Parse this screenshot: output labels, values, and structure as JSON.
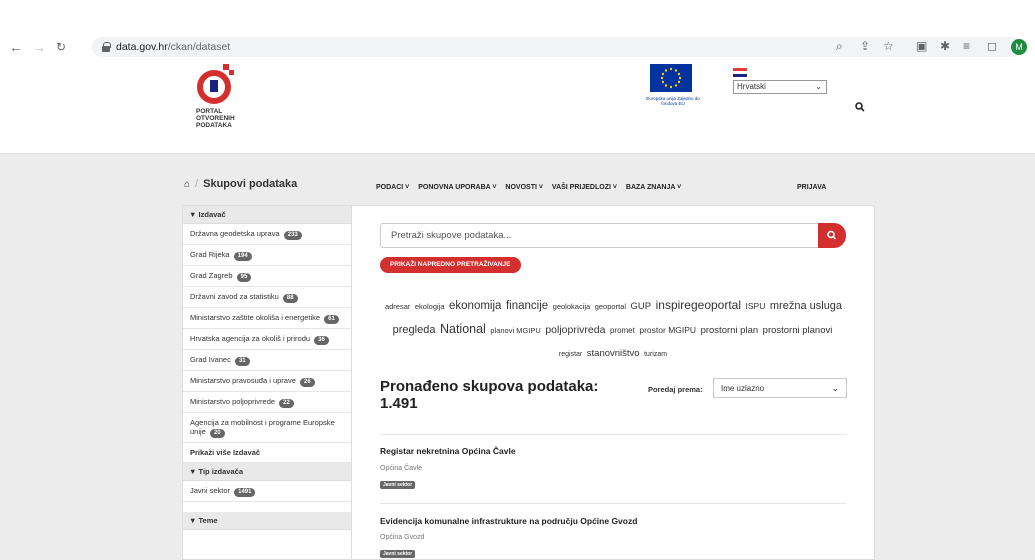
{
  "browser": {
    "url_host": "data.gov.hr",
    "url_path": "/ckan/dataset",
    "avatar_letter": "M"
  },
  "header": {
    "logo_lines": [
      "PORTAL",
      "OTVORENIH",
      "PODATAKA"
    ],
    "eu_text": "Europska unija Zajedno do fondova EU",
    "language": "Hrvatski",
    "nav": [
      "PODACI ˅",
      "PONOVNA UPORABA ˅",
      "NOVOSTI ˅",
      "VAŠI PRIJEDLOZI ˅",
      "BAZA ZNANJA ˅"
    ],
    "login": "PRIJAVA"
  },
  "breadcrumb": {
    "current": "Skupovi podataka"
  },
  "sidebar": {
    "publisher_heading": "Izdavač",
    "publishers": [
      {
        "name": "Državna geodetska uprava",
        "count": "233"
      },
      {
        "name": "Grad Rijeka",
        "count": "194"
      },
      {
        "name": "Grad Zagreb",
        "count": "95"
      },
      {
        "name": "Državni zavod za statistiku",
        "count": "88"
      },
      {
        "name": "Ministarstvo zaštite okoliša i energetike",
        "count": "61"
      },
      {
        "name": "Hrvatska agencija za okoliš i prirodu",
        "count": "36"
      },
      {
        "name": "Grad Ivanec",
        "count": "31"
      },
      {
        "name": "Ministarstvo pravosuđa i uprave",
        "count": "26"
      },
      {
        "name": "Ministarstvo poljoprivrede",
        "count": "22"
      },
      {
        "name": "Agencija za mobilnost i programe Europske unije",
        "count": "20"
      }
    ],
    "show_more": "Prikaži više Izdavač",
    "publisher_type_heading": "Tip izdavača",
    "publisher_types": [
      {
        "name": "Javni sektor",
        "count": "1491"
      }
    ],
    "themes_heading": "Teme"
  },
  "main": {
    "search_placeholder": "Pretraži skupove podataka...",
    "advanced_search": "PRIKAŽI NAPREDNO PRETRAŽIVANJE",
    "tags": [
      {
        "t": "adresar",
        "s": 7.5
      },
      {
        "t": "ekologija",
        "s": 7.5
      },
      {
        "t": "ekonomija",
        "s": 11.5
      },
      {
        "t": "financije",
        "s": 11.5
      },
      {
        "t": "geolokacija",
        "s": 7.5
      },
      {
        "t": "geoportal",
        "s": 7.5
      },
      {
        "t": "GUP",
        "s": 9.5
      },
      {
        "t": "inspiregeoportal",
        "s": 12
      },
      {
        "t": "ISPU",
        "s": 8.5
      },
      {
        "t": "mrežna usluga pregleda",
        "s": 11
      },
      {
        "t": "National",
        "s": 12.5
      },
      {
        "t": "planovi MGIPU",
        "s": 7.5
      },
      {
        "t": "poljoprivreda",
        "s": 10.5
      },
      {
        "t": "promet",
        "s": 8
      },
      {
        "t": "prostor MGIPU",
        "s": 8.5
      },
      {
        "t": "prostorni plan",
        "s": 9.5
      },
      {
        "t": "prostorni planovi",
        "s": 9.5
      },
      {
        "t": "registar",
        "s": 7
      },
      {
        "t": "stanovništvo",
        "s": 9.5
      },
      {
        "t": "turizam",
        "s": 7
      }
    ],
    "result_heading": "Pronađeno skupova podataka:",
    "result_count": "1.491",
    "sort_label": "Poredaj prema:",
    "sort_value": "Ime uzlazno",
    "datasets": [
      {
        "title": "Registar nekretnina Općina Čavle",
        "org": "Općina Čavle",
        "tag": "Javni sektor"
      },
      {
        "title": "Evidencija komunalne infrastrukture na području Općine Gvozd",
        "org": "Općina Gvozd",
        "tag": "Javni sektor"
      }
    ]
  }
}
